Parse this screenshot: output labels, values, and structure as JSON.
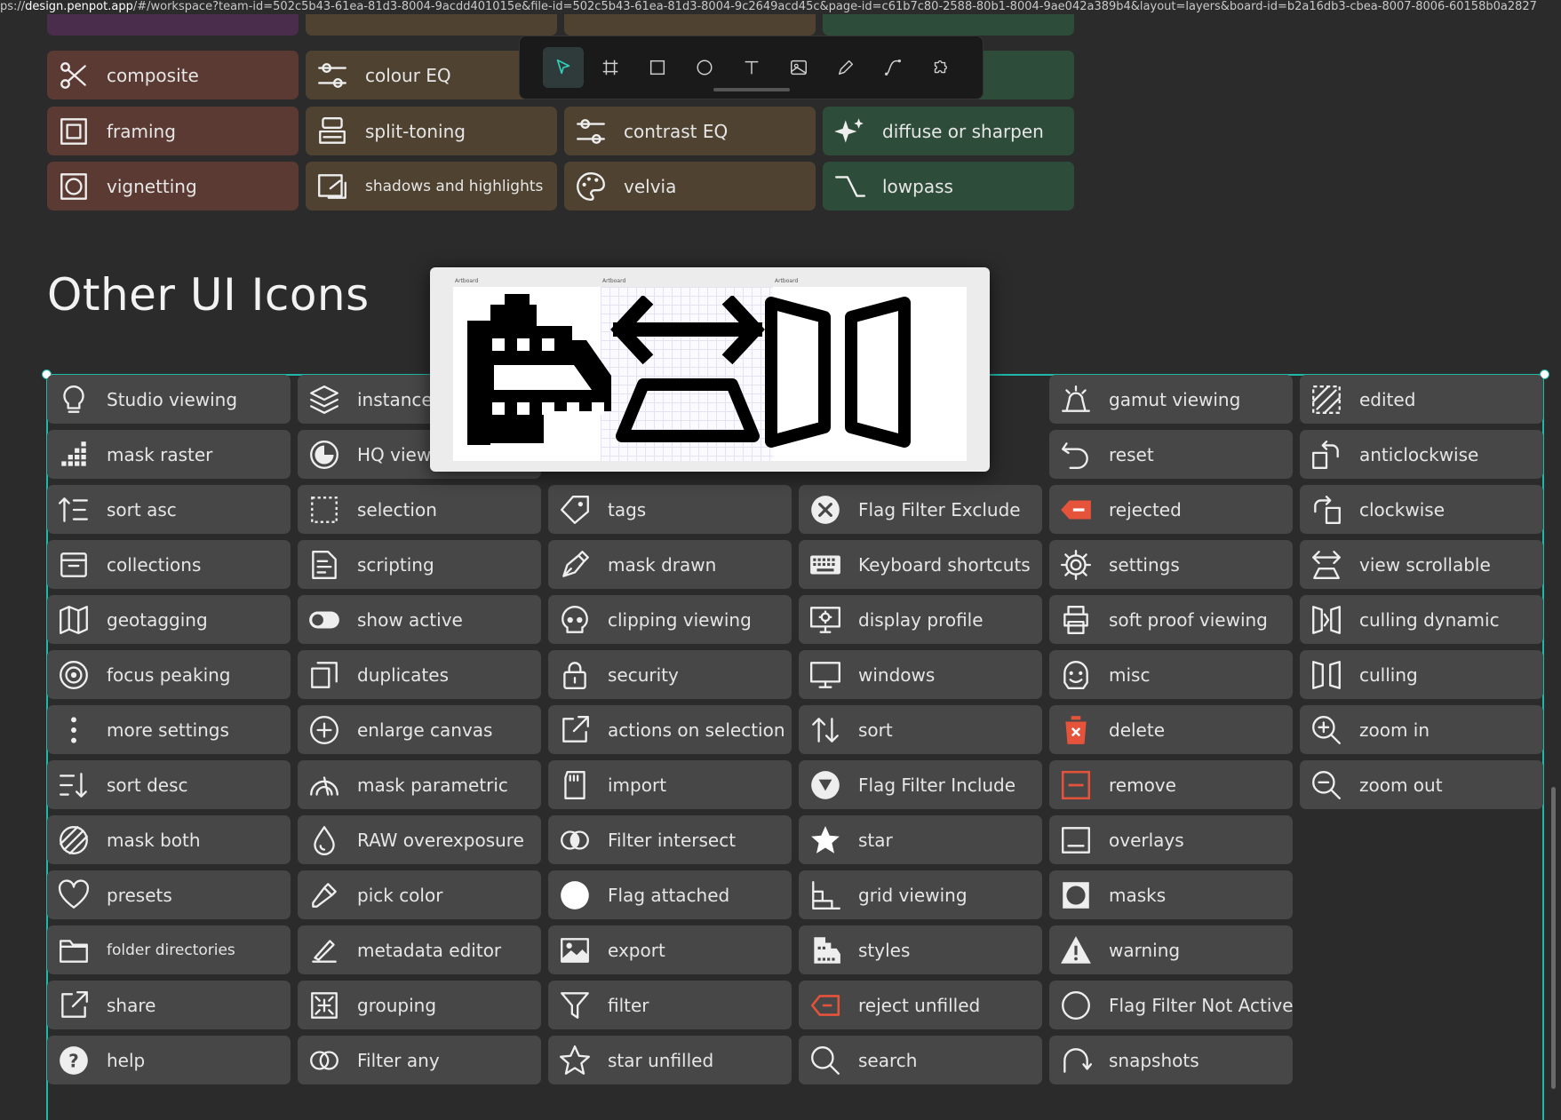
{
  "url": {
    "prefix": "ps://",
    "host": "design.penpot.app",
    "rest": "/#/workspace?team-id=502c5b43-61ea-81d3-8004-9acdd401015e&file-id=502c5b43-61ea-81d3-8004-9c2649acd45c&page-id=c61b7c80-2588-80b1-8004-9ae042a389b4&layout=layers&board-id=b2a16db3-cbea-8007-8006-60158b0a2827"
  },
  "section_title": "Other UI Icons",
  "preview_labels": [
    "Artboard",
    "Artboard",
    "Artboard"
  ],
  "toolbar": [
    {
      "name": "move-tool",
      "icon": "cursor-icon"
    },
    {
      "name": "board-tool",
      "icon": "board-icon"
    },
    {
      "name": "rectangle-tool",
      "icon": "rectangle-icon"
    },
    {
      "name": "ellipse-tool",
      "icon": "ellipse-icon"
    },
    {
      "name": "text-tool",
      "icon": "text-icon"
    },
    {
      "name": "image-tool",
      "icon": "image-icon"
    },
    {
      "name": "pencil-tool",
      "icon": "pencil-icon"
    },
    {
      "name": "path-tool",
      "icon": "path-icon"
    },
    {
      "name": "plugins-tool",
      "icon": "puzzle-icon"
    }
  ],
  "top_tiles": [
    {
      "label": "composite",
      "icon": "scissors-icon",
      "theme": "brown",
      "col": 0,
      "row": 0
    },
    {
      "label": "colour EQ",
      "icon": "sliders-icon",
      "theme": "olive",
      "col": 1,
      "row": 0
    },
    {
      "label": "framing",
      "icon": "frame-icon",
      "theme": "brown",
      "col": 0,
      "row": 1
    },
    {
      "label": "split-toning",
      "icon": "stamp-icon",
      "theme": "olive",
      "col": 1,
      "row": 1
    },
    {
      "label": "contrast EQ",
      "icon": "sliders-icon",
      "theme": "olive",
      "col": 2,
      "row": 1
    },
    {
      "label": "diffuse or sharpen",
      "icon": "sparkle-icon",
      "theme": "green",
      "col": 3,
      "row": 1
    },
    {
      "label": "vignetting",
      "icon": "vignette-icon",
      "theme": "brown",
      "col": 0,
      "row": 2
    },
    {
      "label": "shadows and highlights",
      "icon": "shadows-icon",
      "theme": "olive",
      "col": 1,
      "row": 2,
      "small": true
    },
    {
      "label": "velvia",
      "icon": "palette-icon",
      "theme": "olive",
      "col": 2,
      "row": 2
    },
    {
      "label": "lowpass",
      "icon": "lowpass-icon",
      "theme": "green",
      "col": 3,
      "row": 2
    }
  ],
  "columns": [
    [
      {
        "label": "Studio viewing",
        "icon": "bulb-icon"
      },
      {
        "label": "mask raster",
        "icon": "raster-icon"
      },
      {
        "label": "sort asc",
        "icon": "sort-asc-icon"
      },
      {
        "label": "collections",
        "icon": "archive-icon"
      },
      {
        "label": "geotagging",
        "icon": "map-icon"
      },
      {
        "label": "focus peaking",
        "icon": "target-icon"
      },
      {
        "label": "more settings",
        "icon": "dots-vertical-icon"
      },
      {
        "label": "sort desc",
        "icon": "sort-desc-icon"
      },
      {
        "label": "mask both",
        "icon": "mask-both-icon"
      },
      {
        "label": "presets",
        "icon": "heart-icon"
      },
      {
        "label": "folder directories",
        "icon": "folder-icon",
        "small": true
      },
      {
        "label": "share",
        "icon": "share-icon"
      },
      {
        "label": "help",
        "icon": "help-icon"
      }
    ],
    [
      {
        "label": "instances",
        "icon": "layers-icon"
      },
      {
        "label": "HQ viewing",
        "icon": "hq-icon"
      },
      {
        "label": "selection",
        "icon": "selection-icon"
      },
      {
        "label": "scripting",
        "icon": "script-icon"
      },
      {
        "label": "show active",
        "icon": "toggle-icon"
      },
      {
        "label": "duplicates",
        "icon": "duplicate-icon"
      },
      {
        "label": "enlarge canvas",
        "icon": "plus-circle-icon"
      },
      {
        "label": "mask parametric",
        "icon": "mask-parametric-icon"
      },
      {
        "label": "RAW overexposure",
        "icon": "drop-icon"
      },
      {
        "label": "pick color",
        "icon": "eyedropper-icon"
      },
      {
        "label": "metadata editor",
        "icon": "edit-icon"
      },
      {
        "label": "grouping",
        "icon": "grouping-icon"
      },
      {
        "label": "Filter any",
        "icon": "filter-any-icon"
      }
    ],
    [
      {
        "label": "",
        "icon": ""
      },
      {
        "label": "",
        "icon": ""
      },
      {
        "label": "tags",
        "icon": "tag-icon"
      },
      {
        "label": "mask drawn",
        "icon": "pen-icon"
      },
      {
        "label": "clipping viewing",
        "icon": "skull-icon"
      },
      {
        "label": "security",
        "icon": "lock-icon"
      },
      {
        "label": "actions on selection",
        "icon": "external-icon"
      },
      {
        "label": "import",
        "icon": "sd-card-icon"
      },
      {
        "label": "Filter intersect",
        "icon": "intersect-icon"
      },
      {
        "label": "Flag attached",
        "icon": "filled-circle-icon"
      },
      {
        "label": "export",
        "icon": "image-icon"
      },
      {
        "label": "filter",
        "icon": "funnel-icon"
      },
      {
        "label": "star unfilled",
        "icon": "star-outline-icon"
      }
    ],
    [
      {
        "label": "",
        "icon": ""
      },
      {
        "label": "",
        "icon": ""
      },
      {
        "label": "Flag Filter Exclude",
        "icon": "x-circle-icon"
      },
      {
        "label": "Keyboard shortcuts",
        "icon": "keyboard-icon"
      },
      {
        "label": "display profile",
        "icon": "display-profile-icon"
      },
      {
        "label": "windows",
        "icon": "monitor-icon"
      },
      {
        "label": "sort",
        "icon": "sort-icon"
      },
      {
        "label": "Flag Filter Include",
        "icon": "flag-include-icon"
      },
      {
        "label": "star",
        "icon": "star-icon"
      },
      {
        "label": "grid viewing",
        "icon": "grid-view-icon"
      },
      {
        "label": "styles",
        "icon": "styles-icon"
      },
      {
        "label": "reject unfilled",
        "icon": "reject-outline-icon"
      },
      {
        "label": "search",
        "icon": "search-icon"
      }
    ],
    [
      {
        "label": "gamut viewing",
        "icon": "alarm-icon"
      },
      {
        "label": "reset",
        "icon": "undo-icon"
      },
      {
        "label": "rejected",
        "icon": "reject-filled-icon"
      },
      {
        "label": "settings",
        "icon": "gear-icon"
      },
      {
        "label": "soft proof viewing",
        "icon": "printer-icon"
      },
      {
        "label": "misc",
        "icon": "face-icon"
      },
      {
        "label": "delete",
        "icon": "trash-icon"
      },
      {
        "label": "remove",
        "icon": "minus-box-icon"
      },
      {
        "label": "overlays",
        "icon": "overlay-icon"
      },
      {
        "label": "masks",
        "icon": "mask-icon"
      },
      {
        "label": "warning",
        "icon": "warning-icon"
      },
      {
        "label": "Flag Filter Not Active",
        "icon": "circle-outline-icon"
      },
      {
        "label": "snapshots",
        "icon": "snapshot-icon"
      }
    ],
    [
      {
        "label": "edited",
        "icon": "edited-icon"
      },
      {
        "label": "anticlockwise",
        "icon": "rotate-left-icon"
      },
      {
        "label": "clockwise",
        "icon": "rotate-right-icon"
      },
      {
        "label": "view scrollable",
        "icon": "scrollable-icon"
      },
      {
        "label": "culling dynamic",
        "icon": "culling-dynamic-icon"
      },
      {
        "label": "culling",
        "icon": "culling-icon"
      },
      {
        "label": "zoom in",
        "icon": "zoom-in-icon"
      },
      {
        "label": "zoom out",
        "icon": "zoom-out-icon"
      }
    ]
  ],
  "colors": {
    "accent": "#1fb8a8",
    "reject": "#e5533a"
  }
}
